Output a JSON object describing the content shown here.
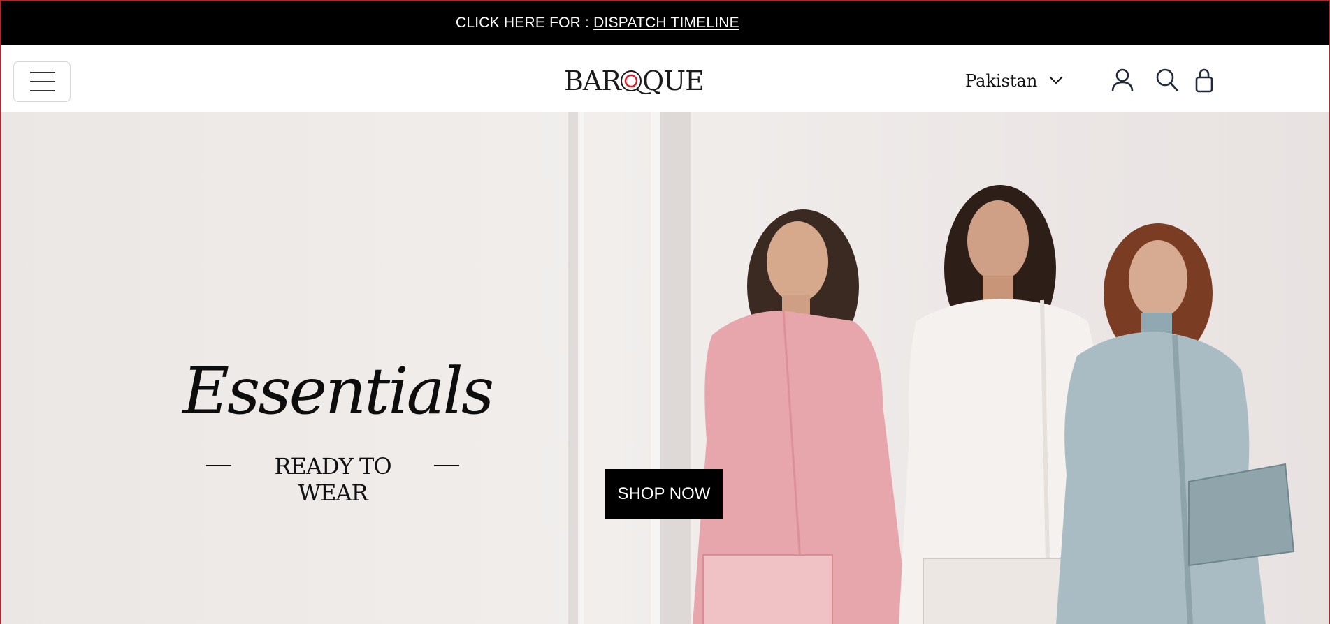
{
  "announcement": {
    "prefix": "CLICK HERE FOR : ",
    "link_label": "DISPATCH TIMELINE"
  },
  "header": {
    "logo_text": "BAROQUE",
    "country": "Pakistan",
    "icons": [
      "hamburger-menu-icon",
      "chevron-down-icon",
      "user-icon",
      "search-icon",
      "bag-icon"
    ]
  },
  "hero": {
    "headline": "Essentials",
    "subheading": "READY TO WEAR",
    "cta_label": "SHOP NOW"
  },
  "colors": {
    "announcement_bg": "#000000",
    "logo_accent": "#d7202a",
    "dress_pink": "#e7a6ab",
    "dress_white": "#f5f1ee",
    "dress_blue": "#a9bcc3"
  }
}
